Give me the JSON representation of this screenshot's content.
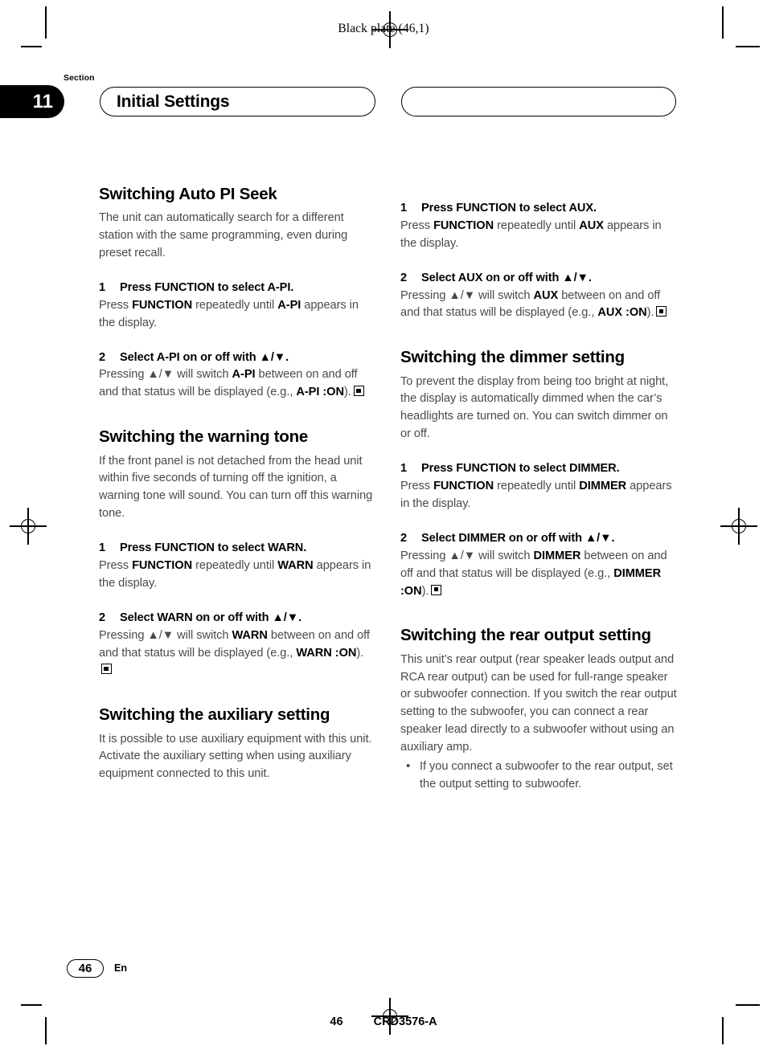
{
  "print_marks": {
    "black_plate_label": "Black plate (46,1)"
  },
  "header": {
    "section_word": "Section",
    "section_number": "11",
    "title": "Initial Settings",
    "right_banner_title": ""
  },
  "left_column": [
    {
      "id": "auto-pi-seek",
      "title": "Switching Auto PI Seek",
      "intro": "The unit can automatically search for a different station with the same programming, even during preset recall.",
      "steps": [
        {
          "num": "1",
          "head": "Press FUNCTION to select A-PI.",
          "body_parts": [
            {
              "t": "Press ",
              "b": false
            },
            {
              "t": "FUNCTION",
              "b": true
            },
            {
              "t": " repeatedly until ",
              "b": false
            },
            {
              "t": "A-PI",
              "b": true
            },
            {
              "t": " appears in the display.",
              "b": false
            }
          ],
          "endmark": false
        },
        {
          "num": "2",
          "head": "Select A-PI on or off with ▲/▼.",
          "body_parts": [
            {
              "t": "Pressing ▲/▼ will switch ",
              "b": false
            },
            {
              "t": "A-PI",
              "b": true
            },
            {
              "t": " between on and off and that status will be displayed (e.g., ",
              "b": false
            },
            {
              "t": "A-PI :ON",
              "b": true
            },
            {
              "t": ").",
              "b": false
            }
          ],
          "endmark": true
        }
      ]
    },
    {
      "id": "warning-tone",
      "title": "Switching the warning tone",
      "intro": "If the front panel is not detached from the head unit within five seconds of turning off the ignition, a warning tone will sound. You can turn off this warning tone.",
      "steps": [
        {
          "num": "1",
          "head": "Press FUNCTION to select WARN.",
          "body_parts": [
            {
              "t": "Press ",
              "b": false
            },
            {
              "t": "FUNCTION",
              "b": true
            },
            {
              "t": " repeatedly until ",
              "b": false
            },
            {
              "t": "WARN",
              "b": true
            },
            {
              "t": " appears in the display.",
              "b": false
            }
          ],
          "endmark": false
        },
        {
          "num": "2",
          "head": "Select WARN on or off with ▲/▼.",
          "body_parts": [
            {
              "t": "Pressing ▲/▼ will switch ",
              "b": false
            },
            {
              "t": "WARN",
              "b": true
            },
            {
              "t": " between on and off and that status will be displayed (e.g., ",
              "b": false
            },
            {
              "t": "WARN :ON",
              "b": true
            },
            {
              "t": ").",
              "b": false
            }
          ],
          "endmark": true
        }
      ]
    },
    {
      "id": "auxiliary-setting",
      "title": "Switching the auxiliary setting",
      "intro": "It is possible to use auxiliary equipment with this unit. Activate the auxiliary setting when using auxiliary equipment connected to this unit.",
      "steps": []
    }
  ],
  "right_column": [
    {
      "id": "auxiliary-setting-steps",
      "title": "",
      "intro": "",
      "steps": [
        {
          "num": "1",
          "head": "Press FUNCTION to select AUX.",
          "body_parts": [
            {
              "t": "Press ",
              "b": false
            },
            {
              "t": "FUNCTION",
              "b": true
            },
            {
              "t": " repeatedly until ",
              "b": false
            },
            {
              "t": "AUX",
              "b": true
            },
            {
              "t": " appears in the display.",
              "b": false
            }
          ],
          "endmark": false
        },
        {
          "num": "2",
          "head": "Select AUX on or off with ▲/▼.",
          "body_parts": [
            {
              "t": "Pressing ▲/▼ will switch ",
              "b": false
            },
            {
              "t": "AUX",
              "b": true
            },
            {
              "t": " between on and off and that status will be displayed (e.g., ",
              "b": false
            },
            {
              "t": "AUX :ON",
              "b": true
            },
            {
              "t": ").",
              "b": false
            }
          ],
          "endmark": true
        }
      ]
    },
    {
      "id": "dimmer-setting",
      "title": "Switching the dimmer setting",
      "intro": "To prevent the display from being too bright at night, the display is automatically dimmed when the car’s headlights are turned on. You can switch dimmer on or off.",
      "steps": [
        {
          "num": "1",
          "head": "Press FUNCTION to select DIMMER.",
          "body_parts": [
            {
              "t": "Press ",
              "b": false
            },
            {
              "t": "FUNCTION",
              "b": true
            },
            {
              "t": " repeatedly until ",
              "b": false
            },
            {
              "t": "DIMMER",
              "b": true
            },
            {
              "t": " appears in the display.",
              "b": false
            }
          ],
          "endmark": false
        },
        {
          "num": "2",
          "head": "Select DIMMER on or off with ▲/▼.",
          "body_parts": [
            {
              "t": "Pressing ▲/▼ will switch ",
              "b": false
            },
            {
              "t": "DIMMER",
              "b": true
            },
            {
              "t": " between on and off and that status will be displayed (e.g., ",
              "b": false
            },
            {
              "t": "DIMMER :ON",
              "b": true
            },
            {
              "t": ").",
              "b": false
            }
          ],
          "endmark": true
        }
      ]
    },
    {
      "id": "rear-output-setting",
      "title": "Switching the rear output setting",
      "intro": "This unit’s rear output (rear speaker leads output and RCA rear output) can be used for full-range speaker or subwoofer connection. If you switch the rear output setting to the subwoofer, you can connect a rear speaker lead directly to a subwoofer without using an auxiliary amp.",
      "steps": [],
      "bullets": [
        "If you connect a subwoofer to the rear output, set the output setting to subwoofer."
      ]
    }
  ],
  "footer": {
    "page_number": "46",
    "language": "En",
    "bottom_page_number": "46",
    "document_code": "CRD3576-A"
  }
}
